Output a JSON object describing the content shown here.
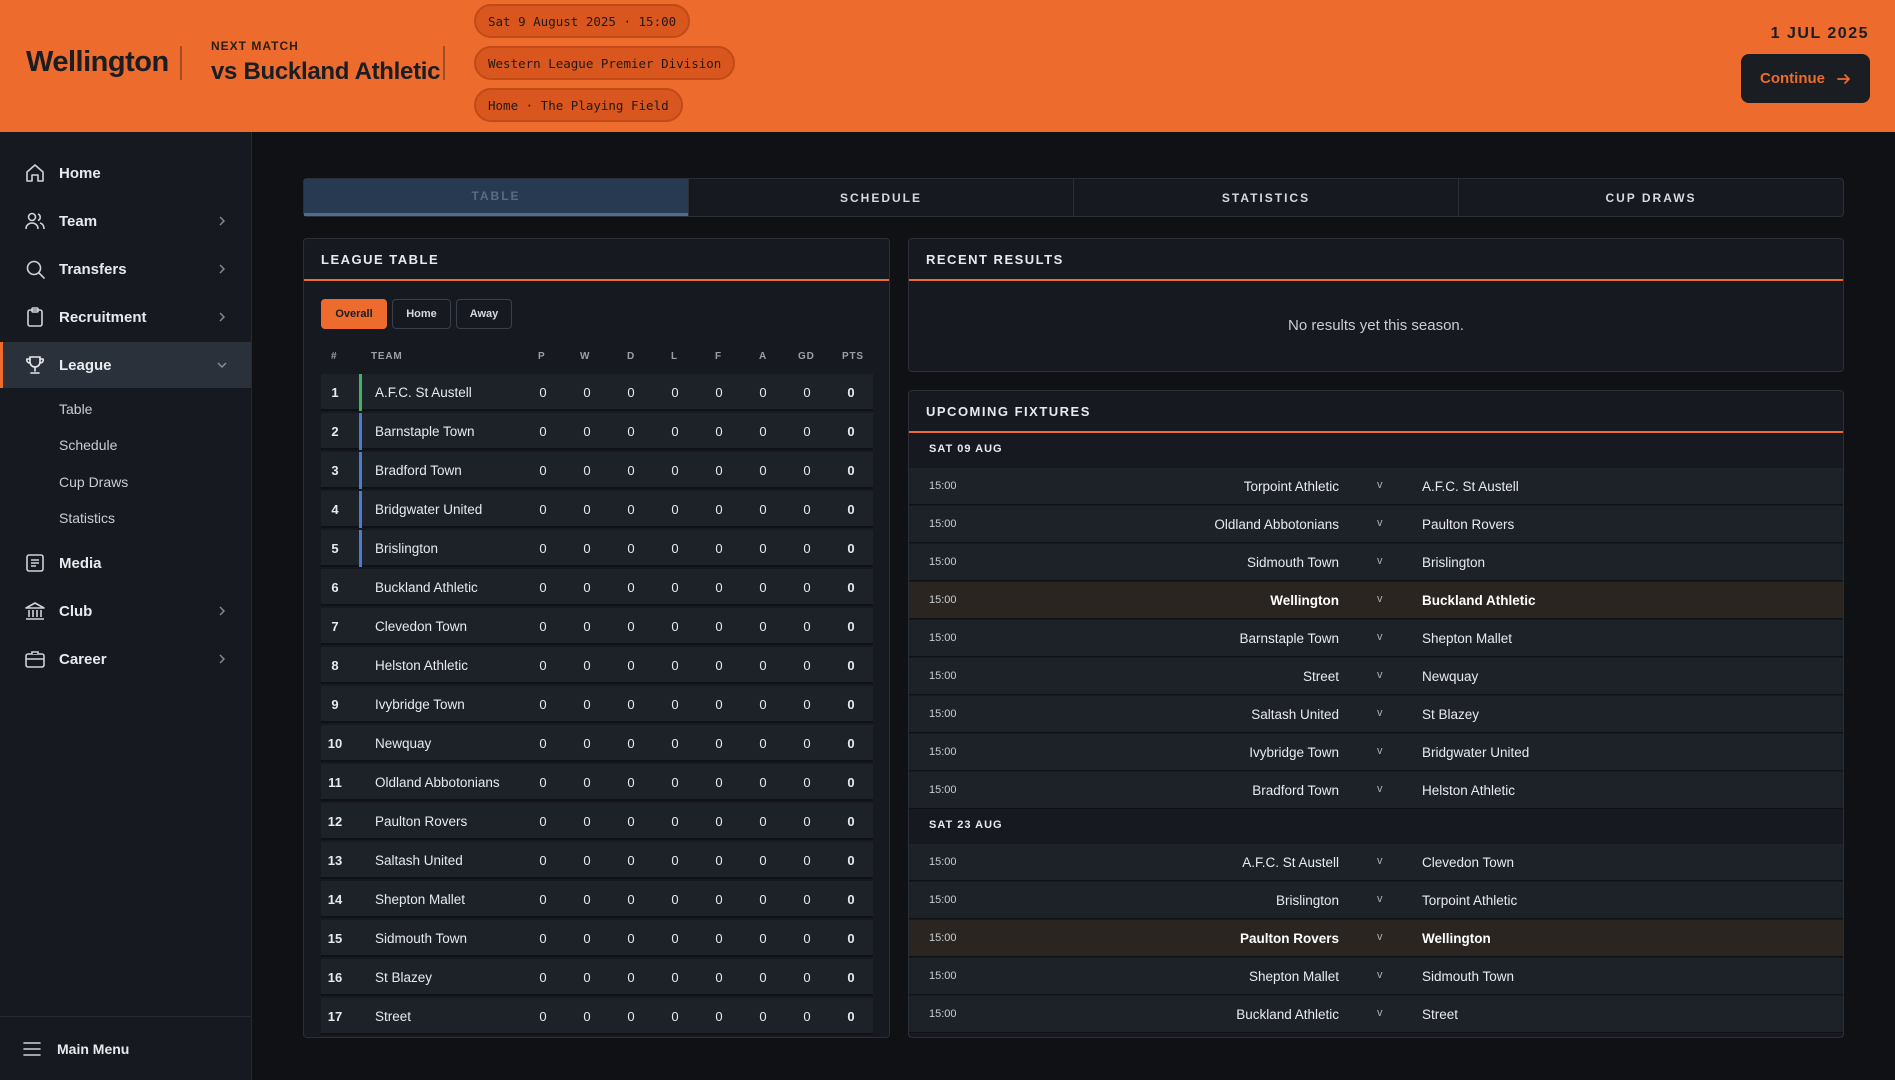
{
  "header": {
    "club": "Wellington",
    "next_label": "NEXT MATCH",
    "opponent": "vs Buckland Athletic",
    "pills": [
      "Sat 9 August 2025 · 15:00",
      "Western League Premier Division",
      "Home · The Playing Field"
    ],
    "date": "1 JUL 2025",
    "continue_label": "Continue"
  },
  "sidebar": {
    "items": [
      {
        "label": "Home",
        "icon": "home-icon",
        "chevron": false
      },
      {
        "label": "Team",
        "icon": "users-icon",
        "chevron": true
      },
      {
        "label": "Transfers",
        "icon": "search-icon",
        "chevron": true
      },
      {
        "label": "Recruitment",
        "icon": "clipboard-icon",
        "chevron": true
      },
      {
        "label": "League",
        "icon": "trophy-icon",
        "chevron": true,
        "active": true
      },
      {
        "label": "Media",
        "icon": "newspaper-icon",
        "chevron": false
      },
      {
        "label": "Club",
        "icon": "bank-icon",
        "chevron": true
      },
      {
        "label": "Career",
        "icon": "briefcase-icon",
        "chevron": true
      }
    ],
    "subitems": [
      "Table",
      "Schedule",
      "Cup Draws",
      "Statistics"
    ],
    "main_menu": "Main Menu"
  },
  "tabs": [
    {
      "label": "TABLE",
      "active": true
    },
    {
      "label": "SCHEDULE",
      "active": false
    },
    {
      "label": "STATISTICS",
      "active": false
    },
    {
      "label": "CUP DRAWS",
      "active": false
    }
  ],
  "league_table": {
    "title": "LEAGUE TABLE",
    "filters": [
      "Overall",
      "Home",
      "Away"
    ],
    "columns": [
      "#",
      "TEAM",
      "P",
      "W",
      "D",
      "L",
      "F",
      "A",
      "GD",
      "PTS"
    ],
    "rows": [
      {
        "pos": "1",
        "team": "A.F.C. St Austell",
        "stats": [
          "0",
          "0",
          "0",
          "0",
          "0",
          "0",
          "0",
          "0"
        ],
        "zone": "#3fb55e"
      },
      {
        "pos": "2",
        "team": "Barnstaple Town",
        "stats": [
          "0",
          "0",
          "0",
          "0",
          "0",
          "0",
          "0",
          "0"
        ],
        "zone": "#4a7bd0"
      },
      {
        "pos": "3",
        "team": "Bradford Town",
        "stats": [
          "0",
          "0",
          "0",
          "0",
          "0",
          "0",
          "0",
          "0"
        ],
        "zone": "#4a7bd0"
      },
      {
        "pos": "4",
        "team": "Bridgwater United",
        "stats": [
          "0",
          "0",
          "0",
          "0",
          "0",
          "0",
          "0",
          "0"
        ],
        "zone": "#4a7bd0"
      },
      {
        "pos": "5",
        "team": "Brislington",
        "stats": [
          "0",
          "0",
          "0",
          "0",
          "0",
          "0",
          "0",
          "0"
        ],
        "zone": "#4a7bd0"
      },
      {
        "pos": "6",
        "team": "Buckland Athletic",
        "stats": [
          "0",
          "0",
          "0",
          "0",
          "0",
          "0",
          "0",
          "0"
        ],
        "zone": ""
      },
      {
        "pos": "7",
        "team": "Clevedon Town",
        "stats": [
          "0",
          "0",
          "0",
          "0",
          "0",
          "0",
          "0",
          "0"
        ],
        "zone": ""
      },
      {
        "pos": "8",
        "team": "Helston Athletic",
        "stats": [
          "0",
          "0",
          "0",
          "0",
          "0",
          "0",
          "0",
          "0"
        ],
        "zone": ""
      },
      {
        "pos": "9",
        "team": "Ivybridge Town",
        "stats": [
          "0",
          "0",
          "0",
          "0",
          "0",
          "0",
          "0",
          "0"
        ],
        "zone": ""
      },
      {
        "pos": "10",
        "team": "Newquay",
        "stats": [
          "0",
          "0",
          "0",
          "0",
          "0",
          "0",
          "0",
          "0"
        ],
        "zone": ""
      },
      {
        "pos": "11",
        "team": "Oldland Abbotonians",
        "stats": [
          "0",
          "0",
          "0",
          "0",
          "0",
          "0",
          "0",
          "0"
        ],
        "zone": ""
      },
      {
        "pos": "12",
        "team": "Paulton Rovers",
        "stats": [
          "0",
          "0",
          "0",
          "0",
          "0",
          "0",
          "0",
          "0"
        ],
        "zone": ""
      },
      {
        "pos": "13",
        "team": "Saltash United",
        "stats": [
          "0",
          "0",
          "0",
          "0",
          "0",
          "0",
          "0",
          "0"
        ],
        "zone": ""
      },
      {
        "pos": "14",
        "team": "Shepton Mallet",
        "stats": [
          "0",
          "0",
          "0",
          "0",
          "0",
          "0",
          "0",
          "0"
        ],
        "zone": ""
      },
      {
        "pos": "15",
        "team": "Sidmouth Town",
        "stats": [
          "0",
          "0",
          "0",
          "0",
          "0",
          "0",
          "0",
          "0"
        ],
        "zone": ""
      },
      {
        "pos": "16",
        "team": "St Blazey",
        "stats": [
          "0",
          "0",
          "0",
          "0",
          "0",
          "0",
          "0",
          "0"
        ],
        "zone": ""
      },
      {
        "pos": "17",
        "team": "Street",
        "stats": [
          "0",
          "0",
          "0",
          "0",
          "0",
          "0",
          "0",
          "0"
        ],
        "zone": ""
      }
    ]
  },
  "recent_results": {
    "title": "RECENT RESULTS",
    "empty": "No results yet this season."
  },
  "fixtures": {
    "title": "UPCOMING FIXTURES",
    "groups": [
      {
        "date": "SAT 09 AUG",
        "matches": [
          {
            "time": "15:00",
            "home": "Torpoint Athletic",
            "away": "A.F.C. St Austell",
            "hl": false
          },
          {
            "time": "15:00",
            "home": "Oldland Abbotonians",
            "away": "Paulton Rovers",
            "hl": false
          },
          {
            "time": "15:00",
            "home": "Sidmouth Town",
            "away": "Brislington",
            "hl": false
          },
          {
            "time": "15:00",
            "home": "Wellington",
            "away": "Buckland Athletic",
            "hl": true
          },
          {
            "time": "15:00",
            "home": "Barnstaple Town",
            "away": "Shepton Mallet",
            "hl": false
          },
          {
            "time": "15:00",
            "home": "Street",
            "away": "Newquay",
            "hl": false
          },
          {
            "time": "15:00",
            "home": "Saltash United",
            "away": "St Blazey",
            "hl": false
          },
          {
            "time": "15:00",
            "home": "Ivybridge Town",
            "away": "Bridgwater United",
            "hl": false
          },
          {
            "time": "15:00",
            "home": "Bradford Town",
            "away": "Helston Athletic",
            "hl": false
          }
        ]
      },
      {
        "date": "SAT 23 AUG",
        "matches": [
          {
            "time": "15:00",
            "home": "A.F.C. St Austell",
            "away": "Clevedon Town",
            "hl": false
          },
          {
            "time": "15:00",
            "home": "Brislington",
            "away": "Torpoint Athletic",
            "hl": false
          },
          {
            "time": "15:00",
            "home": "Paulton Rovers",
            "away": "Wellington",
            "hl": true
          },
          {
            "time": "15:00",
            "home": "Shepton Mallet",
            "away": "Sidmouth Town",
            "hl": false
          },
          {
            "time": "15:00",
            "home": "Buckland Athletic",
            "away": "Street",
            "hl": false
          }
        ]
      }
    ],
    "vs": "v"
  },
  "colors": {
    "accent": "#ec6b2d",
    "background": "#0f1115",
    "panel": "#161a20"
  }
}
